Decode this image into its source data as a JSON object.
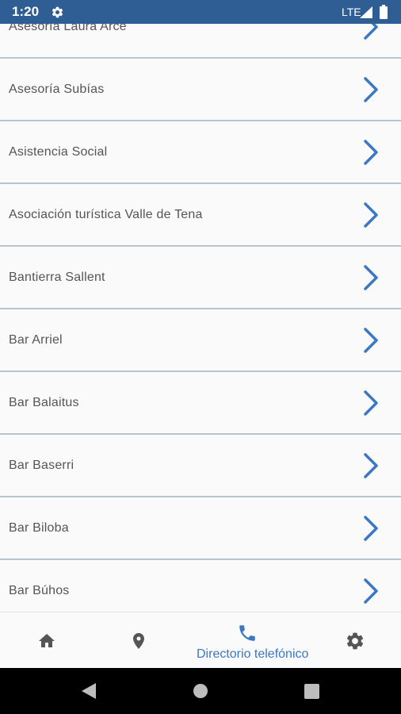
{
  "status_bar": {
    "time": "1:20",
    "network": "LTE",
    "icons": [
      "gear-icon",
      "signal-icon",
      "battery-icon"
    ],
    "background": "#2f5e94"
  },
  "directory": {
    "items": [
      {
        "label": "Asesoría Laura Arce"
      },
      {
        "label": "Asesoría Subías"
      },
      {
        "label": "Asistencia Social"
      },
      {
        "label": "Asociación turística Valle de Tena"
      },
      {
        "label": "Bantierra Sallent"
      },
      {
        "label": "Bar Arriel"
      },
      {
        "label": "Bar Balaitus"
      },
      {
        "label": "Bar Baserri"
      },
      {
        "label": "Bar Biloba"
      },
      {
        "label": "Bar Búhos"
      }
    ],
    "chevron_icon": "chevron-right-icon",
    "accent": "#3b78c4"
  },
  "bottom_nav": {
    "items": [
      {
        "icon": "home-icon"
      },
      {
        "icon": "map-pin-icon"
      },
      {
        "icon": "phone-icon",
        "label": "Directorio telefónico",
        "active": true
      },
      {
        "icon": "settings-icon"
      }
    ],
    "active_color": "#3b78c4",
    "inactive_color": "#555555"
  },
  "system_nav": {
    "icons": [
      "back-icon",
      "home-circle-icon",
      "recents-icon"
    ]
  }
}
